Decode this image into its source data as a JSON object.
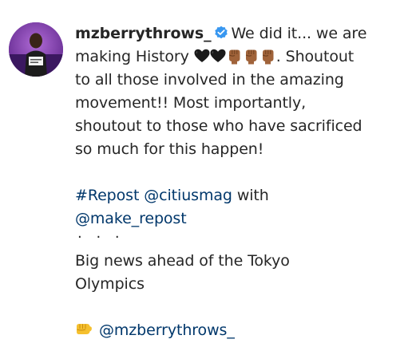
{
  "post": {
    "avatar_icon": "profile-photo",
    "username": "mzberrythrows_",
    "verified_icon": "verified-badge-icon",
    "line1_text": "We did it... we are",
    "line2_text": "making History",
    "emojis_line2": [
      "black-heart",
      "black-heart",
      "raised-fist",
      "raised-fist",
      "raised-fist"
    ],
    "line2_tail": ". Shoutout",
    "line3": "to all those involved in the amazing",
    "line4": "movement!! Most importantly,",
    "line5": "shoutout to those who have sacrificed",
    "line6": "so much for this happen!",
    "hashtag": "#Repost",
    "mention_citius": "@citiusmag",
    "with_word": "with",
    "mention_make_repost": "@make_repost",
    "dots": "· · ·",
    "news_line1": "Big news ahead of the Tokyo",
    "news_line2": "Olympics",
    "punch_emoji": "oncoming-fist",
    "mention_self": "@mzberrythrows_"
  },
  "colors": {
    "text": "#262626",
    "link": "#00376b",
    "verified": "#3897f0",
    "avatar_bg": "#7a3fae"
  }
}
